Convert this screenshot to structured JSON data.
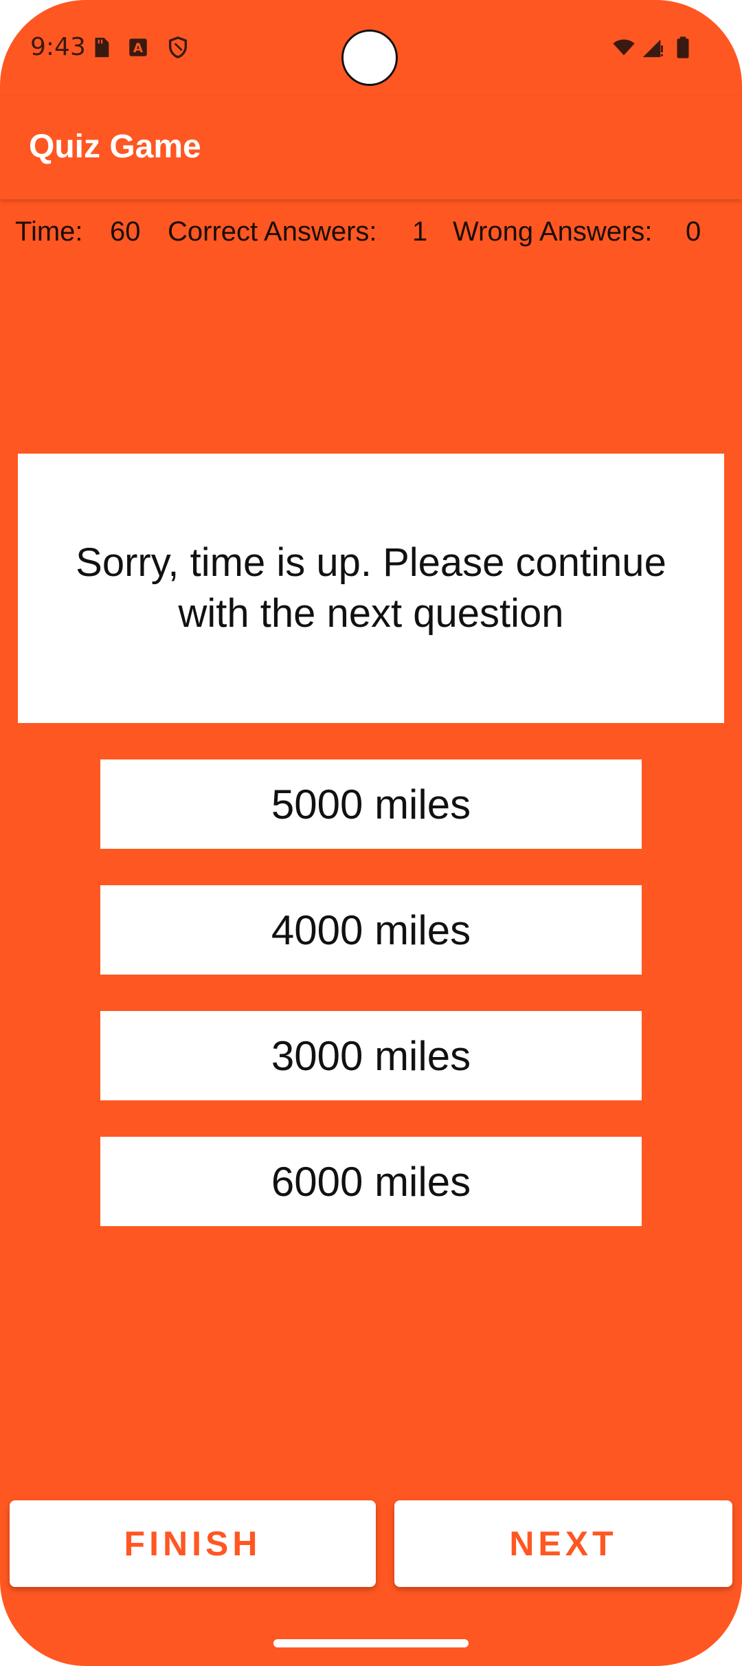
{
  "status_bar": {
    "time": "9:43",
    "icons_left": [
      "sd-card-icon",
      "font-a-icon",
      "shield-icon"
    ],
    "icons_right": [
      "wifi-icon",
      "signal-icon",
      "battery-icon"
    ]
  },
  "app_bar": {
    "title": "Quiz Game"
  },
  "stats": {
    "time_label": "Time:",
    "time_value": "60",
    "correct_label": "Correct Answers:",
    "correct_value": "1",
    "wrong_label": "Wrong Answers:",
    "wrong_value": "0"
  },
  "question": {
    "text": "Sorry, time is up. Please continue with the next question"
  },
  "options": [
    {
      "label": "5000 miles"
    },
    {
      "label": "4000 miles"
    },
    {
      "label": "3000 miles"
    },
    {
      "label": "6000 miles"
    }
  ],
  "buttons": {
    "finish_label": "FINISH",
    "next_label": "NEXT"
  },
  "colors": {
    "background": "#FF5722",
    "surface": "#FFFFFF",
    "accent_text": "#FF5722",
    "text": "#111111"
  }
}
